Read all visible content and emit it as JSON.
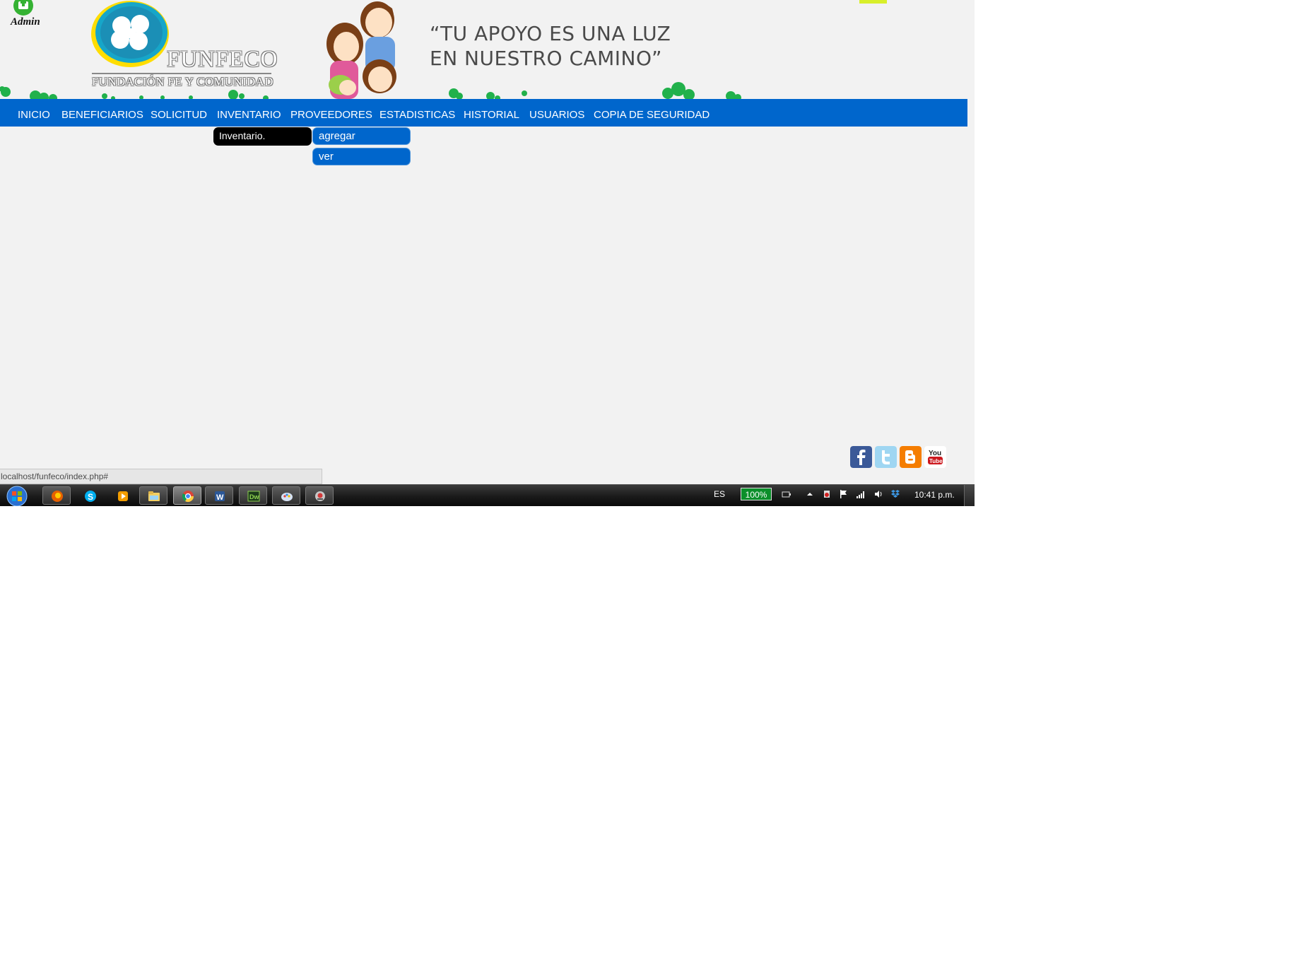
{
  "header": {
    "admin_label": "Admin",
    "logo_name": "FUNFECO",
    "logo_subtitle": "FUNDACIÓN FE Y COMUNIDAD",
    "slogan_line1": "“TU APOYO ES UNA LUZ",
    "slogan_line2": "EN NUESTRO CAMINO”"
  },
  "nav": {
    "items": [
      "INICIO",
      "BENEFICIARIOS",
      "SOLICITUD",
      "INVENTARIO",
      "PROVEEDORES",
      "ESTADISTICAS",
      "HISTORIAL",
      "USUARIOS",
      "COPIA DE SEGURIDAD"
    ]
  },
  "dropdown": {
    "main": "Inventario.",
    "sub": [
      "agregar",
      "ver"
    ]
  },
  "social": [
    "facebook-icon",
    "twitter-icon",
    "blogger-icon",
    "youtube-icon"
  ],
  "status_url": "localhost/funfeco/index.php#",
  "taskbar": {
    "apps": [
      "firefox-icon",
      "skype-icon",
      "media-player-icon",
      "folder-icon",
      "chrome-icon",
      "word-icon",
      "dreamweaver-icon",
      "paint-icon",
      "app-icon"
    ],
    "language": "ES",
    "battery": "100%",
    "clock": "10:41 p.m."
  },
  "colors": {
    "nav_blue": "#0066cc",
    "page_bg": "#f2f2f2",
    "dropdown_active": "#000000"
  }
}
